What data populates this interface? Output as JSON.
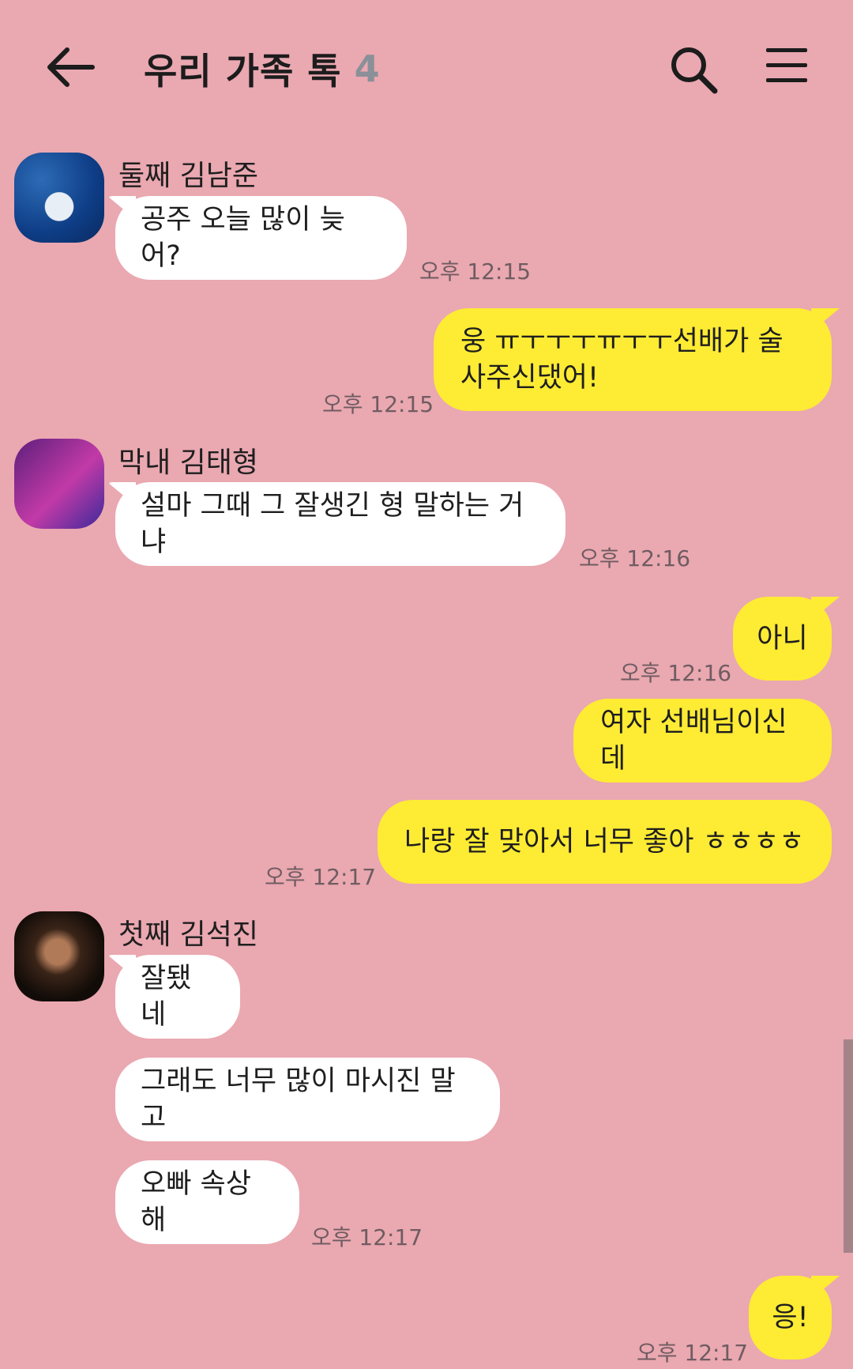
{
  "header": {
    "title": "우리 가족 톡",
    "member_count": "4",
    "icons": {
      "back": "back-arrow-icon",
      "search": "search-icon",
      "menu": "menu-icon"
    }
  },
  "senders": {
    "namjoon": "둘째 김남준",
    "taehyung": "막내 김태형",
    "seokjin": "첫째 김석진"
  },
  "messages": [
    {
      "from": "namjoon",
      "text": "공주 오늘 많이 늦어?",
      "time": "오후 12:15"
    },
    {
      "from": "me",
      "text": "웅 ㅠㅜㅜㅜㅠㅜㅜ선배가 술 사주신댔어!",
      "time": "오후 12:15"
    },
    {
      "from": "taehyung",
      "text": "설마 그때 그 잘생긴 형 말하는 거냐",
      "time": "오후 12:16"
    },
    {
      "from": "me",
      "text": "아니",
      "time": "오후 12:16"
    },
    {
      "from": "me",
      "text": "여자 선배님이신데"
    },
    {
      "from": "me",
      "text": "나랑 잘 맞아서 너무 좋아 ㅎㅎㅎㅎ",
      "time": "오후 12:17"
    },
    {
      "from": "seokjin",
      "text": "잘됐네"
    },
    {
      "from": "seokjin",
      "text": "그래도 너무 많이 마시진 말고"
    },
    {
      "from": "seokjin",
      "text": "오빠 속상해",
      "time": "오후 12:17"
    },
    {
      "from": "me",
      "text": "응!",
      "time": "오후 12:17"
    }
  ],
  "colors": {
    "background": "#EAA8B1",
    "incoming_bubble": "#FFFFFF",
    "outgoing_bubble": "#FEEB34",
    "member_count": "#8A9098"
  }
}
